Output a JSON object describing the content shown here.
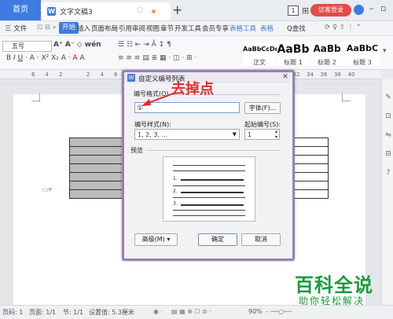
{
  "title_bar": {
    "home_tab": "首页",
    "doc_tab": "文字文稿3",
    "doc_icon": "W",
    "page_indicator": "1",
    "login_button": "访客登录"
  },
  "menu": {
    "file": "三 文件",
    "items": [
      "开始",
      "插入",
      "页面布局",
      "引用",
      "审阅",
      "视图",
      "章节",
      "开发工具",
      "会员专享",
      "表格工具",
      "表格"
    ],
    "search": "Q查找",
    "accent": "#3f7be0"
  },
  "toolbar": {
    "font_size": "五号",
    "style_gallery": [
      {
        "sample": "AaBbCcDd",
        "label": "正文"
      },
      {
        "sample": "AaBb",
        "label": "标题 1"
      },
      {
        "sample": "AaBb",
        "label": "标题 2"
      },
      {
        "sample": "AaBbC",
        "label": "标题 3"
      }
    ]
  },
  "ruler": {
    "numbers": [
      "6",
      "4",
      "2",
      "",
      "2",
      "4",
      "6",
      "8",
      "10",
      "12",
      "14",
      "16",
      "18",
      "20",
      "22",
      "24",
      "26",
      "28",
      "30",
      "32",
      "34",
      "36",
      "38",
      "40"
    ]
  },
  "dialog": {
    "title": "自定义编号列表",
    "format_label": "编号格式(O)",
    "format_value": "①",
    "font_button": "字体(F)...",
    "style_label": "编号样式(N):",
    "style_value": "1, 2, 3, ...",
    "start_label": "起始编号(S):",
    "start_value": "1",
    "preview_label": "预览",
    "preview_numbers": [
      "1.",
      "2.",
      "3."
    ],
    "advanced_button": "高级(M) ▾",
    "ok_button": "确定",
    "cancel_button": "取消"
  },
  "annotation": {
    "text": "去掉点",
    "color": "#e8262d"
  },
  "status_bar": {
    "page": "页码: 1",
    "pages": "页面: 1/1",
    "section": "节: 1/1",
    "setting": "设置值: 5.3厘米",
    "zoom": "90%"
  },
  "watermark": {
    "main": "百科全说",
    "sub": "助你轻松解决",
    "color": "#1a9b3c"
  }
}
